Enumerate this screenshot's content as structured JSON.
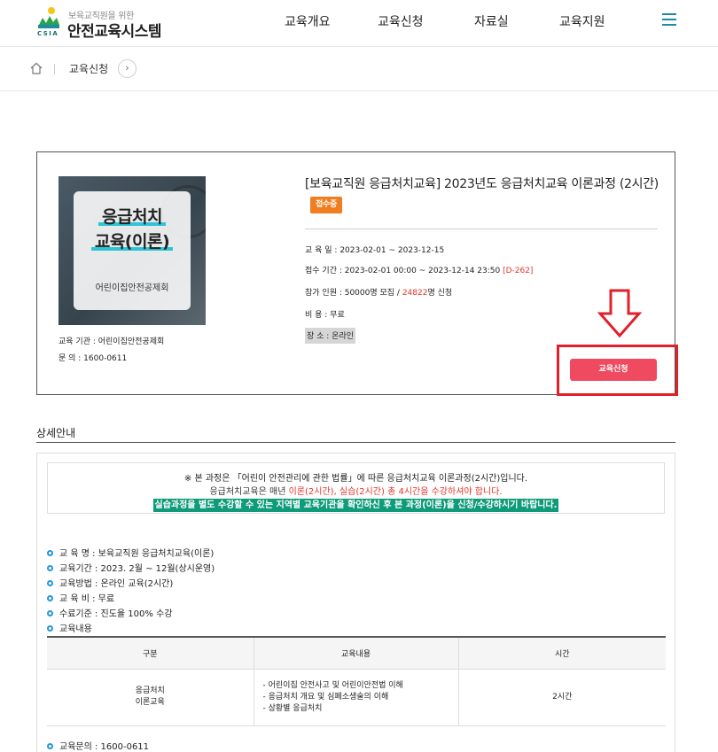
{
  "header": {
    "logo_subtitle": "보육교직원을 위한",
    "logo_title": "안전교육시스템",
    "logo_abbr": "CSIA",
    "nav": [
      "교육개요",
      "교육신청",
      "자료실",
      "교육지원"
    ]
  },
  "breadcrumb": {
    "label": "교육신청",
    "next": "›"
  },
  "course": {
    "thumb_line1": "응급처치",
    "thumb_line2": "교육(이론)",
    "thumb_org": "어린이집안전공제회",
    "institution": "교육 기관 : 어린이집안전공제회",
    "inquiry": "문        의 : 1600-0611",
    "title": "[보육교직원 응급처치교육] 2023년도 응급처치교육 이론과정 (2시간)",
    "status": "접수중",
    "period": "교  육  일 : 2023-02-01 ~ 2023-12-15",
    "reg_period": "접수 기간 : 2023-02-01 00:00 ~ 2023-12-14 23:50 ",
    "dday": "[D-262]",
    "capacity_prefix": "참가 인원 : 50000명 모집 / ",
    "applied": "24822",
    "capacity_suffix": "명 신청",
    "fee": "비        용 : 무료",
    "place": "장        소 : 온라인",
    "apply_button": "교육신청"
  },
  "detail": {
    "section_title": "상세안내",
    "notice_line1": "※ 본 과정은 「어린이 안전관리에 관한 법률」에 따른 응급처치교육 이론과정(2시간)입니다.",
    "notice_line2_a": "응급처치교육은 매년 ",
    "notice_line2_b": "이론(2시간), 실습(2시간) 총 4시간을 수강하셔야 합니다.",
    "notice_line3": "실습과정을 별도 수강할 수 있는 지역별 교육기관을 확인하신 후 본 과정(이론)을 신청/수강하시기 바랍니다.",
    "bullets": [
      "교 육 명 : 보육교직원 응급처치교육(이론)",
      "교육기간 : 2023. 2월 ~ 12월(상시운영)",
      "교육방법 : 온라인 교육(2시간)",
      "교 육 비 : 무료",
      "수료기준 : 진도율 100% 수강",
      "교육내용"
    ],
    "table": {
      "headers": [
        "구분",
        "교육내용",
        "시간"
      ],
      "row_category": "응급처치\n이론교육",
      "row_contents": [
        "- 어린이집 안전사고 및 어린이안전법 이해",
        "- 응급처치 개요 및 심폐소생술의 이해",
        "- 상황별 응급처치"
      ],
      "row_time": "2시간"
    },
    "inquiry": "교육문의 : 1600-0611"
  },
  "colors": {
    "accent": "#1d8ba3",
    "apply": "#ef4a5f",
    "badge": "#f07d1f",
    "highlight_green": "#0e9b7a",
    "annotation_red": "#e0202a"
  }
}
